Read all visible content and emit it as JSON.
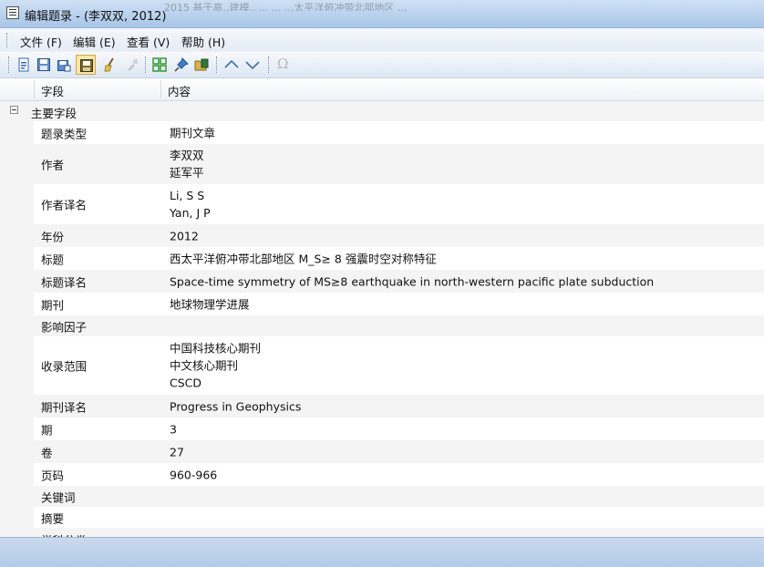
{
  "window": {
    "title": "编辑题录 - (李双双, 2012)",
    "background_ghost_text": "2015    基于高..建模..  ...  ...  ...太平洋俯冲带北部地区 ..."
  },
  "menu": {
    "file": "文件 (F)",
    "edit": "编辑 (E)",
    "view": "查看 (V)",
    "help": "帮助 (H)"
  },
  "toolbar": {
    "buttons": [
      {
        "icon": "new-page-icon"
      },
      {
        "icon": "save-icon"
      },
      {
        "icon": "save-copy-icon"
      },
      {
        "icon": "save-close-icon",
        "active": true
      },
      {
        "icon": "clean-broom-icon"
      },
      {
        "icon": "tool-disabled-icon"
      },
      {
        "icon": "expand-all-icon"
      },
      {
        "icon": "pin-icon"
      },
      {
        "icon": "open-folder-icon"
      },
      {
        "icon": "arrow-up-icon"
      },
      {
        "icon": "arrow-down-icon"
      },
      {
        "icon": "omega-symbol-icon"
      }
    ],
    "omega_glyph": "Ω"
  },
  "grid": {
    "columns": [
      "字段",
      "内容"
    ],
    "group_label": "主要字段",
    "rows": [
      {
        "field": "题录类型",
        "lines": [
          "期刊文章"
        ]
      },
      {
        "field": "作者",
        "lines": [
          "李双双",
          "延军平"
        ]
      },
      {
        "field": "作者译名",
        "lines": [
          "Li, S S",
          "Yan, J P"
        ]
      },
      {
        "field": "年份",
        "lines": [
          "2012"
        ]
      },
      {
        "field": "标题",
        "lines": [
          "西太平洋俯冲带北部地区 M_S≥ 8 强震时空对称特征"
        ]
      },
      {
        "field": "标题译名",
        "lines": [
          "Space-time symmetry of MS≥8 earthquake in north-western pacific plate subduction"
        ]
      },
      {
        "field": "期刊",
        "lines": [
          "地球物理学进展"
        ]
      },
      {
        "field": "影响因子",
        "lines": []
      },
      {
        "field": "收录范围",
        "lines": [
          "中国科技核心期刊",
          "中文核心期刊",
          "CSCD"
        ]
      },
      {
        "field": "期刊译名",
        "lines": [
          "Progress in Geophysics"
        ]
      },
      {
        "field": "期",
        "lines": [
          "3"
        ]
      },
      {
        "field": "卷",
        "lines": [
          "27"
        ]
      },
      {
        "field": "页码",
        "lines": [
          "960-966"
        ]
      },
      {
        "field": "关键词",
        "lines": []
      },
      {
        "field": "摘要",
        "lines": []
      },
      {
        "field": "学科分类",
        "lines": []
      }
    ]
  }
}
